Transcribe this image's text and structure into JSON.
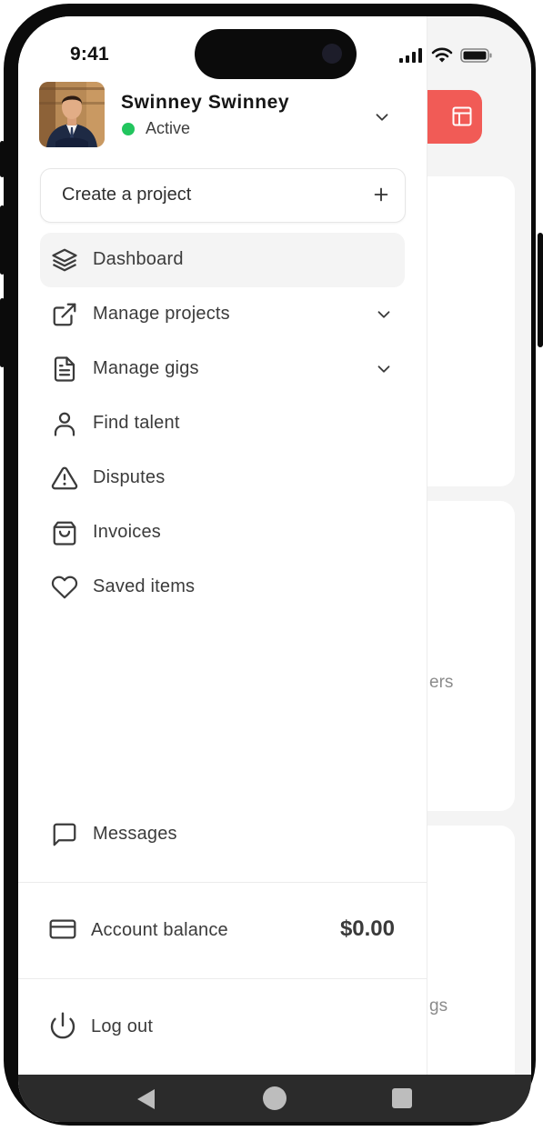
{
  "status_bar": {
    "time": "9:41"
  },
  "account": {
    "name": "Swinney Swinney",
    "status": "Active",
    "status_color": "#22c55e"
  },
  "create_project": {
    "label": "Create a project"
  },
  "nav": {
    "items": [
      {
        "label": "Dashboard",
        "icon": "layers-icon",
        "active": true
      },
      {
        "label": "Manage projects",
        "icon": "external-link-icon",
        "expandable": true
      },
      {
        "label": "Manage gigs",
        "icon": "document-icon",
        "expandable": true
      },
      {
        "label": "Find talent",
        "icon": "user-icon"
      },
      {
        "label": "Disputes",
        "icon": "warning-icon"
      },
      {
        "label": "Invoices",
        "icon": "shopping-bag-icon"
      },
      {
        "label": "Saved items",
        "icon": "heart-icon"
      }
    ],
    "messages": {
      "label": "Messages",
      "icon": "message-icon"
    }
  },
  "balance": {
    "label": "Account balance",
    "value": "$0.00"
  },
  "logout": {
    "label": "Log out"
  },
  "background": {
    "text_1": "ers",
    "text_2": "gs",
    "accent": "#f15b56"
  }
}
